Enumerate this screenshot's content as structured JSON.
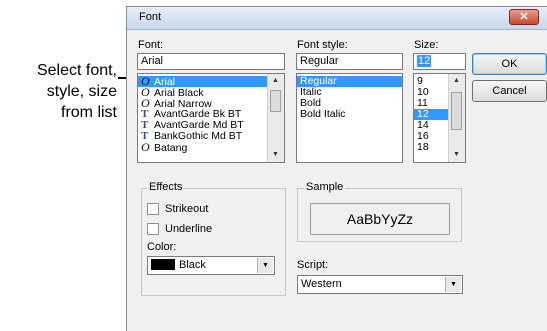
{
  "callout": {
    "lines": [
      "Select font,",
      "style, size",
      "from list"
    ]
  },
  "dialog": {
    "title": "Font",
    "close_glyph": "✕",
    "font_label": "Font:",
    "font_value": "Arial",
    "font_list": [
      {
        "icon": "O",
        "icon_name": "opentype-icon",
        "name": "Arial",
        "selected": true
      },
      {
        "icon": "O",
        "icon_name": "opentype-icon",
        "name": "Arial Black"
      },
      {
        "icon": "O",
        "icon_name": "opentype-icon",
        "name": "Arial Narrow"
      },
      {
        "icon": "T",
        "icon_name": "truetype-icon",
        "name": "AvantGarde Bk BT"
      },
      {
        "icon": "T",
        "icon_name": "truetype-icon",
        "name": "AvantGarde Md BT"
      },
      {
        "icon": "T",
        "icon_name": "truetype-icon",
        "name": "BankGothic Md BT"
      },
      {
        "icon": "O",
        "icon_name": "opentype-icon",
        "name": "Batang"
      }
    ],
    "style_label": "Font style:",
    "style_value": "Regular",
    "style_list": [
      {
        "name": "Regular",
        "selected": true
      },
      {
        "name": "Italic"
      },
      {
        "name": "Bold"
      },
      {
        "name": "Bold Italic"
      }
    ],
    "size_label": "Size:",
    "size_value": "12",
    "size_list": [
      {
        "name": "9"
      },
      {
        "name": "10"
      },
      {
        "name": "11"
      },
      {
        "name": "12",
        "selected": true
      },
      {
        "name": "14"
      },
      {
        "name": "16"
      },
      {
        "name": "18"
      }
    ],
    "ok_label": "OK",
    "cancel_label": "Cancel",
    "effects": {
      "title": "Effects",
      "strikeout_label": "Strikeout",
      "underline_label": "Underline",
      "color_label": "Color:",
      "color_value": "Black"
    },
    "sample": {
      "title": "Sample",
      "text": "AaBbYyZz"
    },
    "script": {
      "label": "Script:",
      "value": "Western"
    }
  },
  "colors": {
    "selection": "#3399ff",
    "dialog_bg": "#f0f0f0",
    "close_button": "#c74a2e"
  }
}
